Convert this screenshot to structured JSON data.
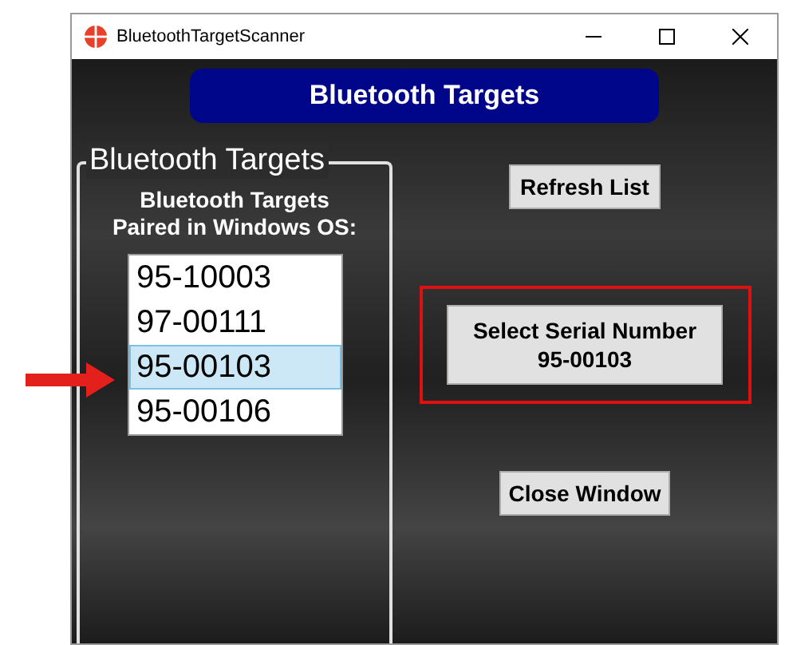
{
  "window": {
    "title": "BluetoothTargetScanner"
  },
  "banner": {
    "title": "Bluetooth Targets"
  },
  "group": {
    "legend": "Bluetooth Targets",
    "caption_lines": [
      "Bluetooth Targets",
      "Paired in Windows OS:"
    ],
    "targets": [
      {
        "label": "95-10003",
        "selected": false
      },
      {
        "label": "97-00111",
        "selected": false
      },
      {
        "label": "95-00103",
        "selected": true
      },
      {
        "label": "95-00106",
        "selected": false
      }
    ]
  },
  "buttons": {
    "refresh": "Refresh List",
    "select_lines": [
      "Select Serial Number",
      "95-00103"
    ],
    "close": "Close Window"
  }
}
